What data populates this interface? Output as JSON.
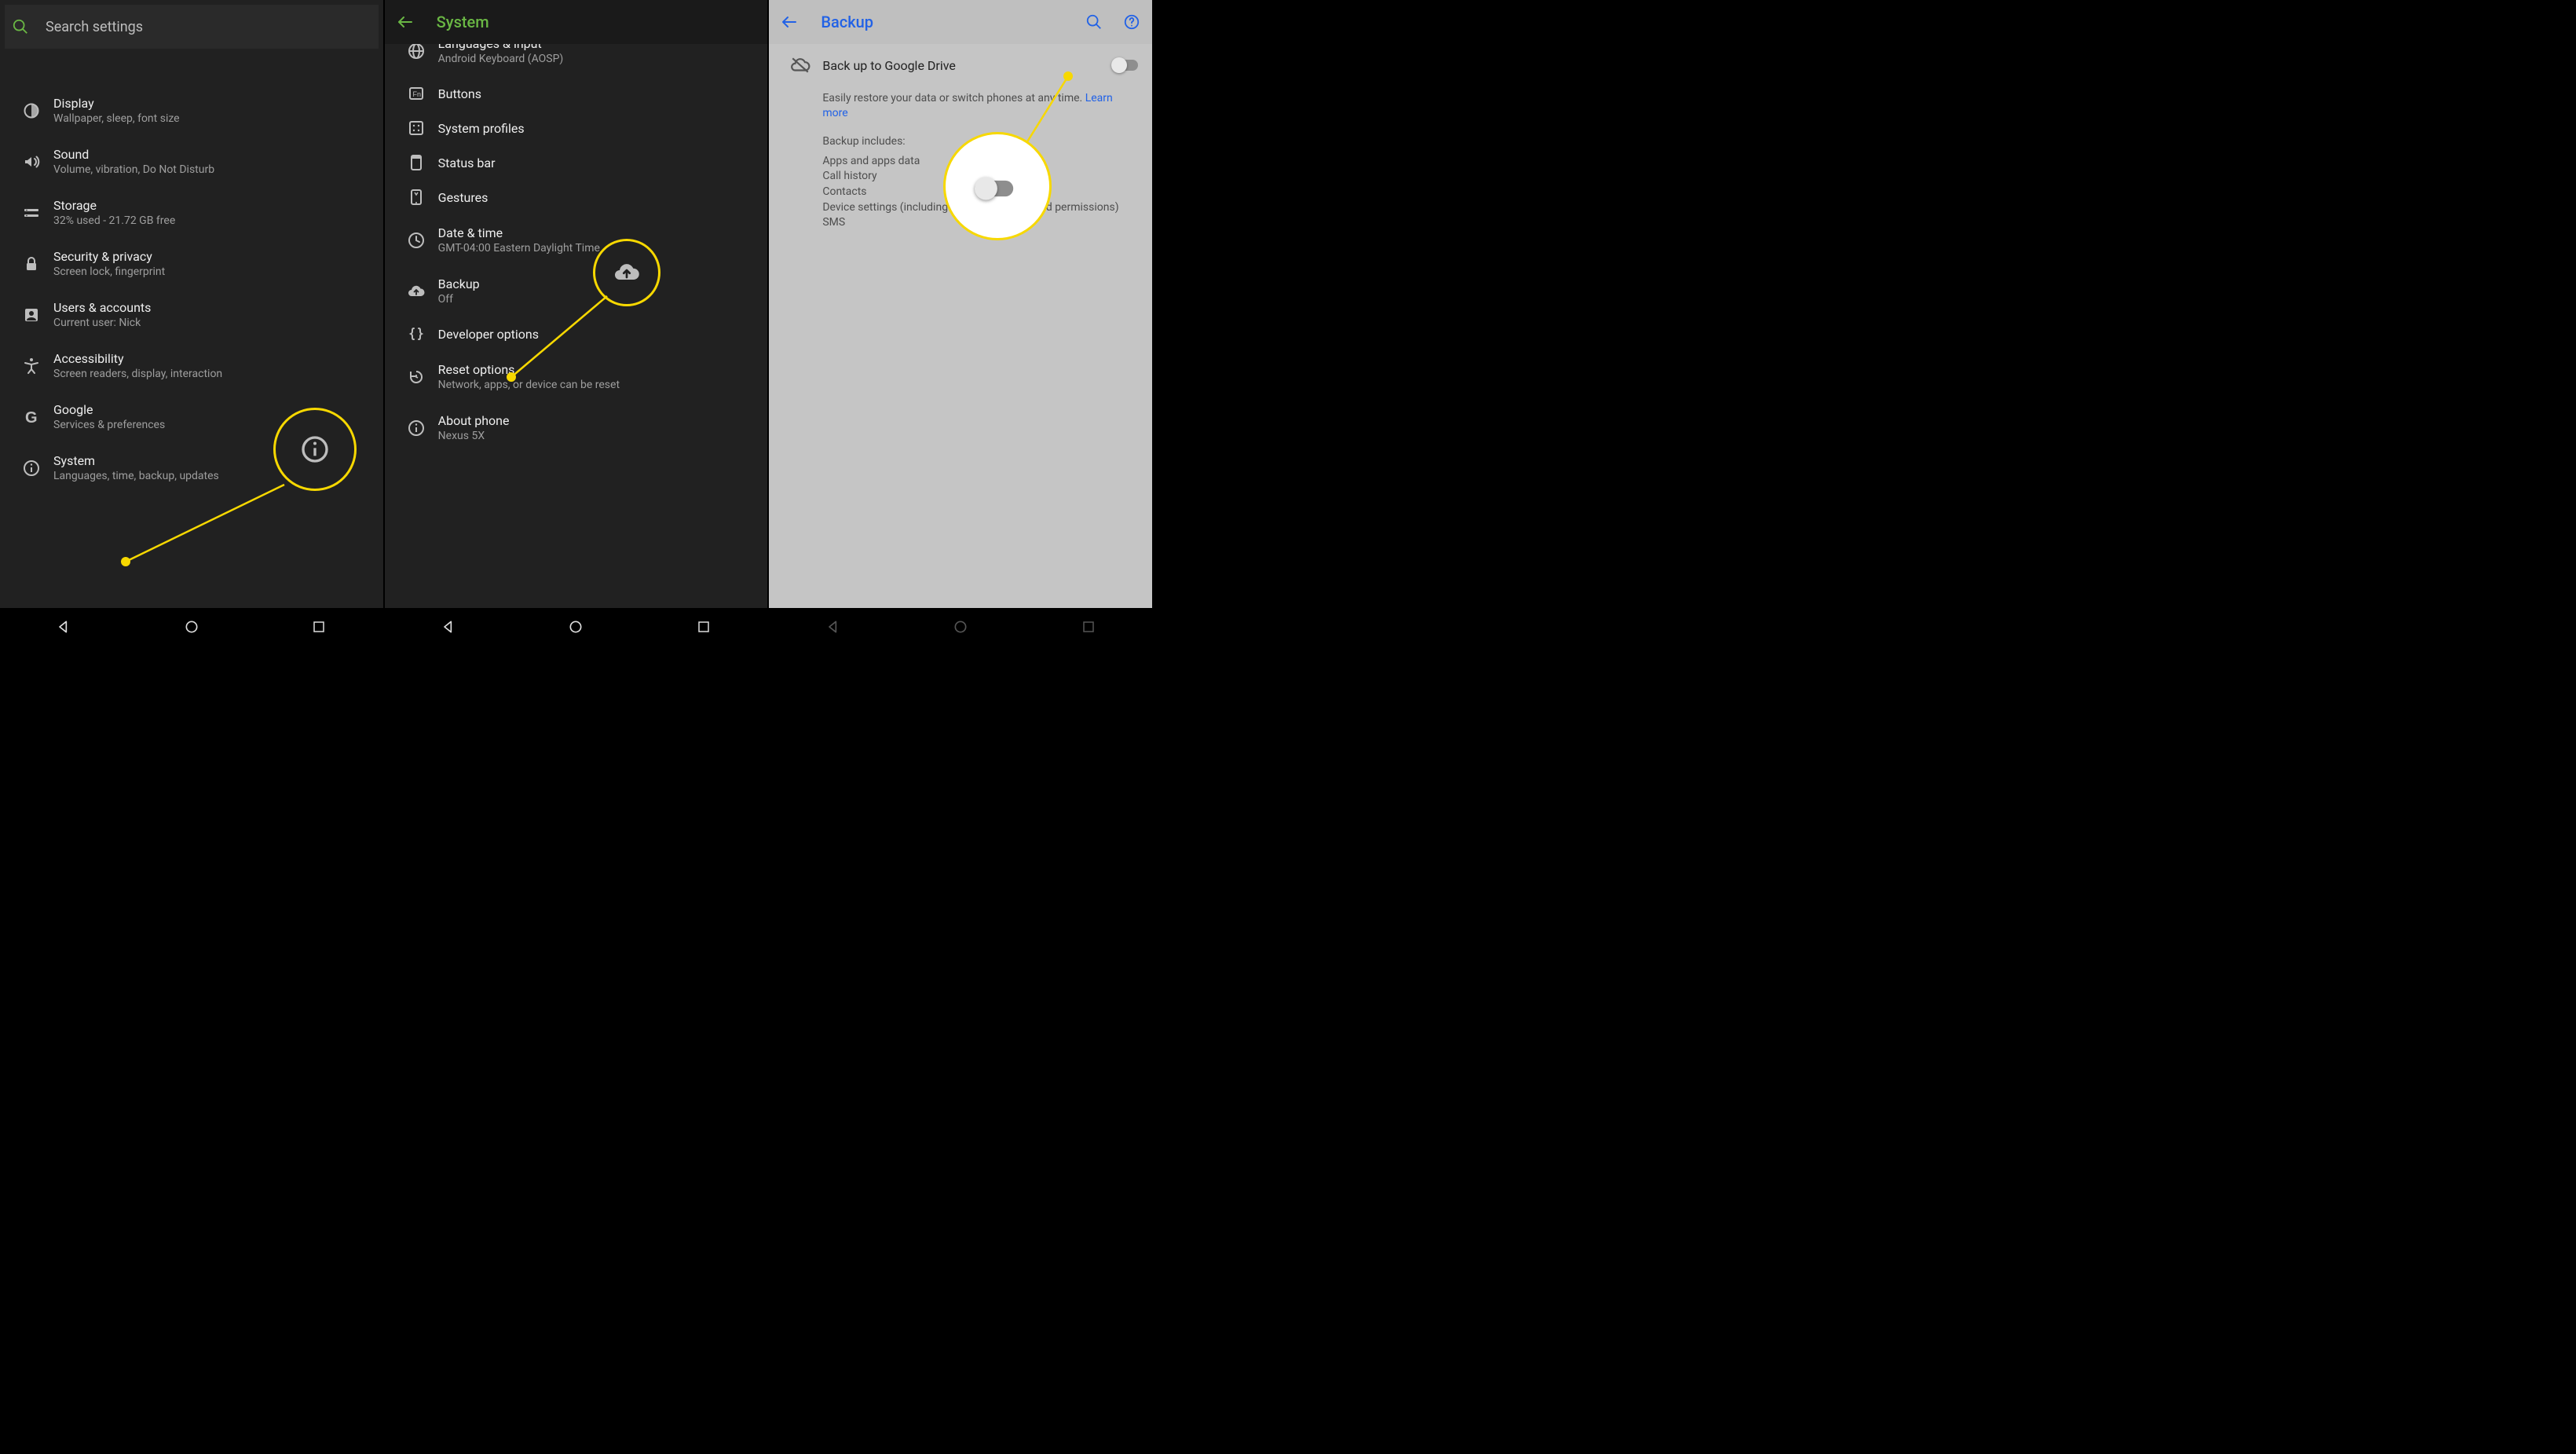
{
  "panel1": {
    "search_placeholder": "Search settings",
    "items": [
      {
        "icon": "display",
        "label": "Display",
        "sub": "Wallpaper, sleep, font size"
      },
      {
        "icon": "sound",
        "label": "Sound",
        "sub": "Volume, vibration, Do Not Disturb"
      },
      {
        "icon": "storage",
        "label": "Storage",
        "sub": "32% used - 21.72 GB free"
      },
      {
        "icon": "lock",
        "label": "Security & privacy",
        "sub": "Screen lock, fingerprint"
      },
      {
        "icon": "users",
        "label": "Users & accounts",
        "sub": "Current user: Nick"
      },
      {
        "icon": "accessibility",
        "label": "Accessibility",
        "sub": "Screen readers, display, interaction"
      },
      {
        "icon": "google",
        "label": "Google",
        "sub": "Services & preferences"
      },
      {
        "icon": "info",
        "label": "System",
        "sub": "Languages, time, backup, updates"
      }
    ]
  },
  "panel2": {
    "title": "System",
    "cutoff": {
      "label": "Languages & input",
      "sub": "Android Keyboard (AOSP)"
    },
    "items": [
      {
        "icon": "fn",
        "label": "Buttons",
        "sub": ""
      },
      {
        "icon": "profiles",
        "label": "System profiles",
        "sub": ""
      },
      {
        "icon": "statusbar",
        "label": "Status bar",
        "sub": ""
      },
      {
        "icon": "gestures",
        "label": "Gestures",
        "sub": ""
      },
      {
        "icon": "clock",
        "label": "Date & time",
        "sub": "GMT-04:00 Eastern Daylight Time"
      },
      {
        "icon": "cloudup",
        "label": "Backup",
        "sub": "Off"
      },
      {
        "icon": "braces",
        "label": "Developer options",
        "sub": ""
      },
      {
        "icon": "restore",
        "label": "Reset options",
        "sub": "Network, apps, or device can be reset"
      },
      {
        "icon": "info",
        "label": "About phone",
        "sub": "Nexus 5X"
      }
    ]
  },
  "panel3": {
    "title": "Backup",
    "toggle_label": "Back up to Google Drive",
    "desc_pre": "Easily restore your data or switch phones at any time. ",
    "learn": "Learn more",
    "includes_head": "Backup includes:",
    "includes": [
      "Apps and apps data",
      "Call history",
      "Contacts",
      "Device settings (including Wi-Fi passwords and permissions)",
      "SMS"
    ]
  }
}
